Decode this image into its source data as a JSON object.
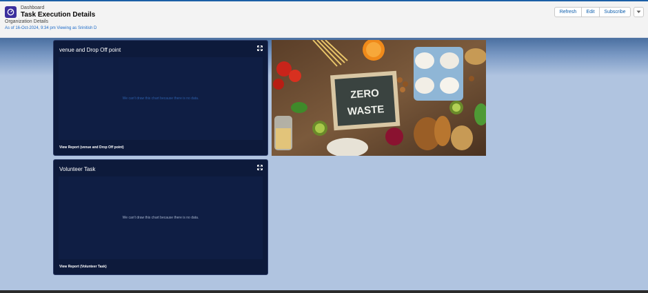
{
  "header": {
    "object_label": "Dashboard",
    "title": "Task Execution Details",
    "subtitle": "Organization Details",
    "as_of": "As of 16-Oct-2024, 9:34 pm Viewing as Srinitish D",
    "app_icon": "dashboard-gauge-icon",
    "buttons": {
      "refresh": "Refresh",
      "edit": "Edit",
      "subscribe": "Subscribe"
    },
    "dropdown_icon": "chevron-down-icon"
  },
  "widgets": [
    {
      "title": "venue and Drop Off point",
      "empty_message": "We can't draw this chart because there is no data.",
      "view_report": "View Report (venue and Drop Off point)",
      "expand_icon": "expand-icon"
    },
    {
      "title": "Volunteer Task",
      "empty_message": "We can't draw this chart because there is no data.",
      "view_report": "View Report (Volunteer Task)",
      "expand_icon": "expand-icon"
    }
  ],
  "image_widget": {
    "sign_line1": "ZERO",
    "sign_line2": "WASTE"
  },
  "colors": {
    "header_bg": "#f3f3f3",
    "card_bg": "#0d1a3b",
    "canvas_bg": "#b0c4e0",
    "link_blue": "#0b5cab",
    "app_icon_bg": "#3b2f9d"
  }
}
